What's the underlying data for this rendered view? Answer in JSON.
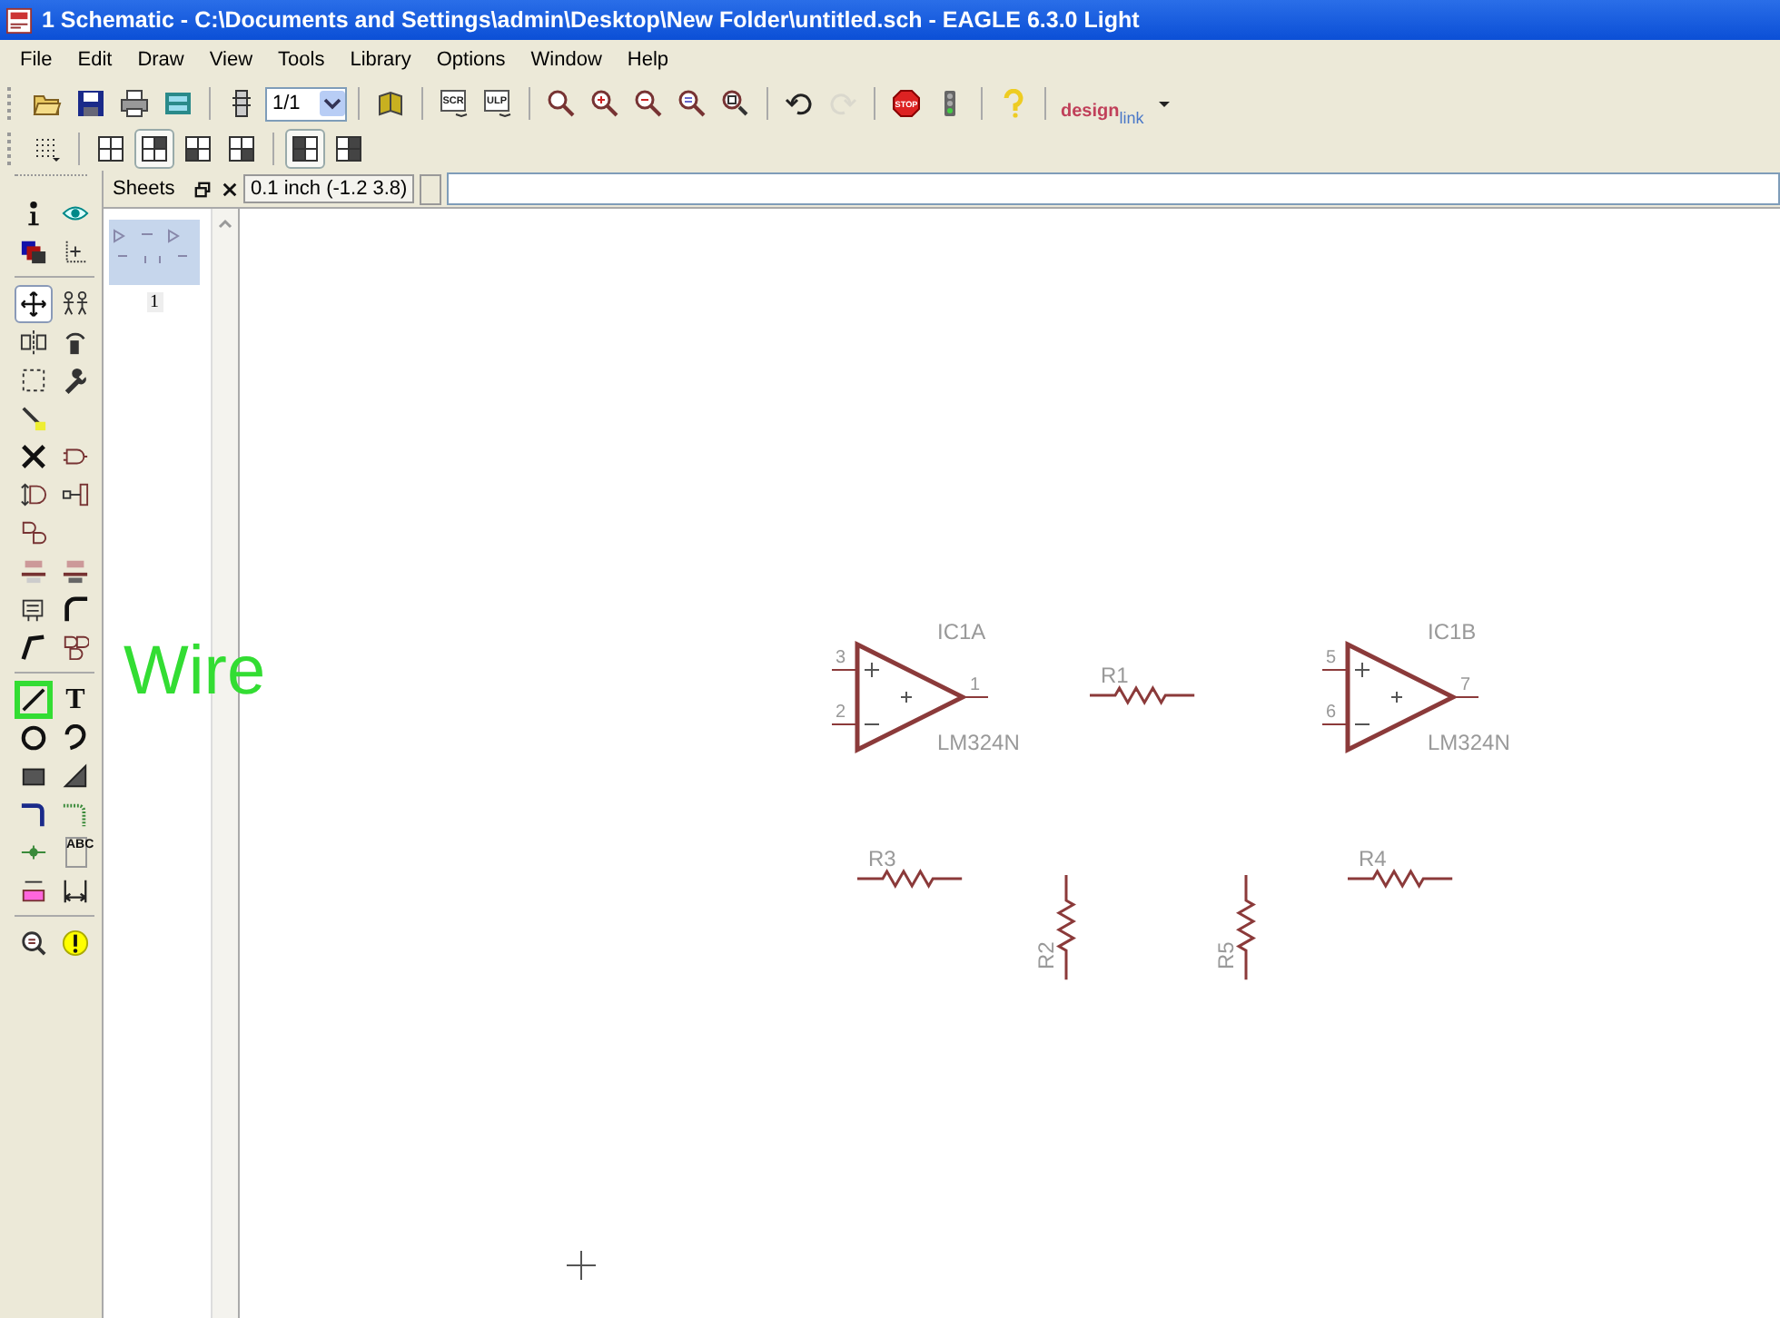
{
  "window": {
    "title": "1 Schematic - C:\\Documents and Settings\\admin\\Desktop\\New Folder\\untitled.sch - EAGLE 6.3.0 Light"
  },
  "menu": [
    "File",
    "Edit",
    "Draw",
    "View",
    "Tools",
    "Library",
    "Options",
    "Window",
    "Help"
  ],
  "toolbar": [
    {
      "kind": "button",
      "disabled": false
    },
    {
      "kind": "button",
      "disabled": false
    },
    {
      "kind": "button",
      "disabled": false
    },
    {
      "kind": "button",
      "disabled": false
    },
    {
      "kind": "button",
      "disabled": false
    },
    {
      "kind": "select",
      "value": "1/1"
    },
    {
      "kind": "button",
      "disabled": false
    },
    {
      "kind": "button",
      "disabled": false,
      "label": "SCR"
    },
    {
      "kind": "button",
      "disabled": false,
      "label": "ULP"
    },
    {
      "kind": "button",
      "disabled": false
    },
    {
      "kind": "button",
      "disabled": false
    },
    {
      "kind": "button",
      "disabled": false
    },
    {
      "kind": "button",
      "disabled": false
    },
    {
      "kind": "button",
      "disabled": false
    },
    {
      "kind": "button",
      "disabled": false
    },
    {
      "kind": "button",
      "disabled": true
    },
    {
      "kind": "button",
      "disabled": false,
      "label": "STOP"
    },
    {
      "kind": "button",
      "disabled": false
    },
    {
      "kind": "button",
      "disabled": false
    },
    {
      "kind": "logo",
      "text": "design",
      "subtext": "link"
    }
  ],
  "layout_toolbar": [
    {
      "selected": false
    },
    {
      "selected": false
    },
    {
      "selected": true
    },
    {
      "selected": false
    },
    {
      "selected": false
    },
    {
      "selected": true
    },
    {
      "selected": false
    }
  ],
  "sheets_panel": {
    "title": "Sheets",
    "sheets": [
      {
        "label": "1",
        "selected": true
      }
    ]
  },
  "command_bar": {
    "grid_reading": "0.1 inch (-1.2 3.8)"
  },
  "tool_palette": [
    [
      [
        {
          "selected": false,
          "highlighted": false
        },
        {
          "selected": false,
          "highlighted": false
        }
      ],
      [
        {
          "selected": false,
          "highlighted": false
        },
        {
          "selected": false,
          "highlighted": false
        }
      ]
    ],
    [
      [
        {
          "selected": true,
          "highlighted": false
        },
        {
          "selected": false,
          "highlighted": false
        }
      ],
      [
        {
          "selected": false,
          "highlighted": false
        },
        {
          "selected": false,
          "highlighted": false
        }
      ],
      [
        {
          "selected": false,
          "highlighted": false
        },
        {
          "selected": false,
          "highlighted": false
        }
      ],
      [
        {
          "selected": false,
          "highlighted": false
        }
      ],
      [
        {
          "selected": false,
          "highlighted": false
        },
        {
          "selected": false,
          "highlighted": false
        }
      ],
      [
        {
          "selected": false,
          "highlighted": false
        },
        {
          "selected": false,
          "highlighted": false
        }
      ],
      [
        {
          "selected": false,
          "highlighted": false
        }
      ],
      [
        {
          "selected": false,
          "highlighted": false
        },
        {
          "selected": false,
          "highlighted": false
        }
      ],
      [
        {
          "selected": false,
          "highlighted": false
        },
        {
          "selected": false,
          "highlighted": false
        }
      ],
      [
        {
          "selected": false,
          "highlighted": false
        },
        {
          "selected": false,
          "highlighted": false
        }
      ]
    ],
    [
      [
        {
          "selected": false,
          "highlighted": true
        },
        {
          "selected": false,
          "highlighted": false,
          "glyph": "T"
        }
      ],
      [
        {
          "selected": false,
          "highlighted": false
        },
        {
          "selected": false,
          "highlighted": false
        }
      ],
      [
        {
          "selected": false,
          "highlighted": false
        },
        {
          "selected": false,
          "highlighted": false
        }
      ],
      [
        {
          "selected": false,
          "highlighted": false
        },
        {
          "selected": false,
          "highlighted": false
        }
      ],
      [
        {
          "selected": false,
          "highlighted": false
        },
        {
          "selected": false,
          "highlighted": false,
          "glyph": "ABC"
        }
      ],
      [
        {
          "selected": false,
          "highlighted": false
        },
        {
          "selected": false,
          "highlighted": false
        }
      ]
    ],
    [
      [
        {
          "selected": false,
          "highlighted": false
        },
        {
          "selected": false,
          "highlighted": false
        }
      ]
    ]
  ],
  "annotation": {
    "text": "Wire"
  },
  "schematic": {
    "opamps": [
      {
        "name": "IC1A",
        "value": "LM324N",
        "pins": [
          "3",
          "2",
          "1"
        ]
      },
      {
        "name": "IC1B",
        "value": "LM324N",
        "pins": [
          "5",
          "6",
          "7"
        ]
      }
    ],
    "resistors": [
      {
        "name": "R1",
        "kind": "horizontal"
      },
      {
        "name": "R3",
        "kind": "horizontal"
      },
      {
        "name": "R4",
        "kind": "horizontal"
      },
      {
        "name": "R2",
        "kind": "vertical"
      },
      {
        "name": "R5",
        "kind": "vertical"
      }
    ]
  }
}
